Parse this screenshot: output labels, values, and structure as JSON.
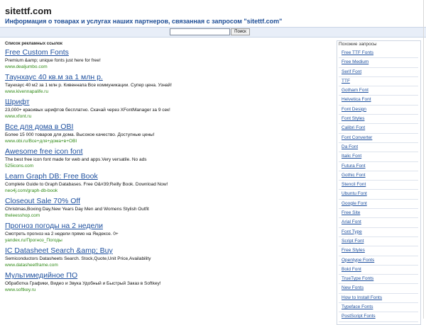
{
  "header": {
    "site_title": "sitettf.com",
    "subtitle": "Информация о товарах и услугах наших партнеров, связанная с запросом \"sitettf.com\""
  },
  "search": {
    "value": "",
    "placeholder": "",
    "button_label": "Поиск"
  },
  "ads": {
    "header": "Список рекламных ссылок",
    "items": [
      {
        "title": "Free Custom Fonts",
        "desc": "Premium &amp; unique fonts just here for free!",
        "url": "www.dealjumbo.com"
      },
      {
        "title": "Таунхаус 40 кв.м за 1 млн р.",
        "desc": "Таунхаус 40 м2 за 1 млн р. Кивеннапа Все коммуникации. Супер цена. Узнай!",
        "url": "www.kivennapalife.ru"
      },
      {
        "title": "Шрифт",
        "desc": "23,000+ красивых шрифтов бесплатно. Скачай через XFontManager за 9 сек!",
        "url": "www.xfont.ru"
      },
      {
        "title": "Все для дома в OBI",
        "desc": "Более 15 000 товаров для дома. Высокое качество. Доступные цены!",
        "url": "www.obi.ru/Все+для+дома+в+OBI"
      },
      {
        "title": "Awesome free icon font",
        "desc": "The best free icon font made for web and apps.Very versatile. No ads",
        "url": "525icons.com"
      },
      {
        "title": "Learn Graph DB: Free Book",
        "desc": "Complete Guide to Graph Databases. Free O&#39;Reilly Book. Download Now!",
        "url": "neo4j.com/graph-db-book"
      },
      {
        "title": "Closeout Sale 70% Off",
        "desc": "Christmas,Boxing Day,New Years Day Men and Womens Stylish Outfit",
        "url": "theleesshop.com"
      },
      {
        "title": "Прогноз погоды на 2 недели",
        "desc": "Смотреть прогноз на 2 недели прямо на Яндексе. 0+",
        "url": "yandex.ru/Прогноз_Погоды"
      },
      {
        "title": "IC Datasheet Search &amp; Buy",
        "desc": "Semiconductors Datasheets Search. Stock,Quote,Unit Price,Availability",
        "url": "www.datasheetframe.com"
      },
      {
        "title": "Мультимедийное ПО",
        "desc": "Обработка Графики, Видео и Звука Удобный и Быстрый Заказ в Softkey!",
        "url": "www.softkey.ru"
      }
    ]
  },
  "sidebar": {
    "header": "Похожие запросы",
    "items": [
      "Free TTF Fonts",
      "Free Medium",
      "Serif Font",
      "TTF",
      "Gotham Font",
      "Helvetica Font",
      "Font Design",
      "Font Styles",
      "Calibri Font",
      "Font Converter",
      "Da Font",
      "Italic Font",
      "Futura Font",
      "Gothic Font",
      "Stencil Font",
      "Ubuntu Font",
      "Google Font",
      "Free Site",
      "Arial Font",
      "Font Type",
      "Script Font",
      "Free Styles",
      "Opentype Fonts",
      "Bold Font",
      "TrueType Fonts",
      "New Fonts",
      "How to Install Fonts",
      "Typeface Fonts",
      "PostScript Fonts"
    ]
  }
}
